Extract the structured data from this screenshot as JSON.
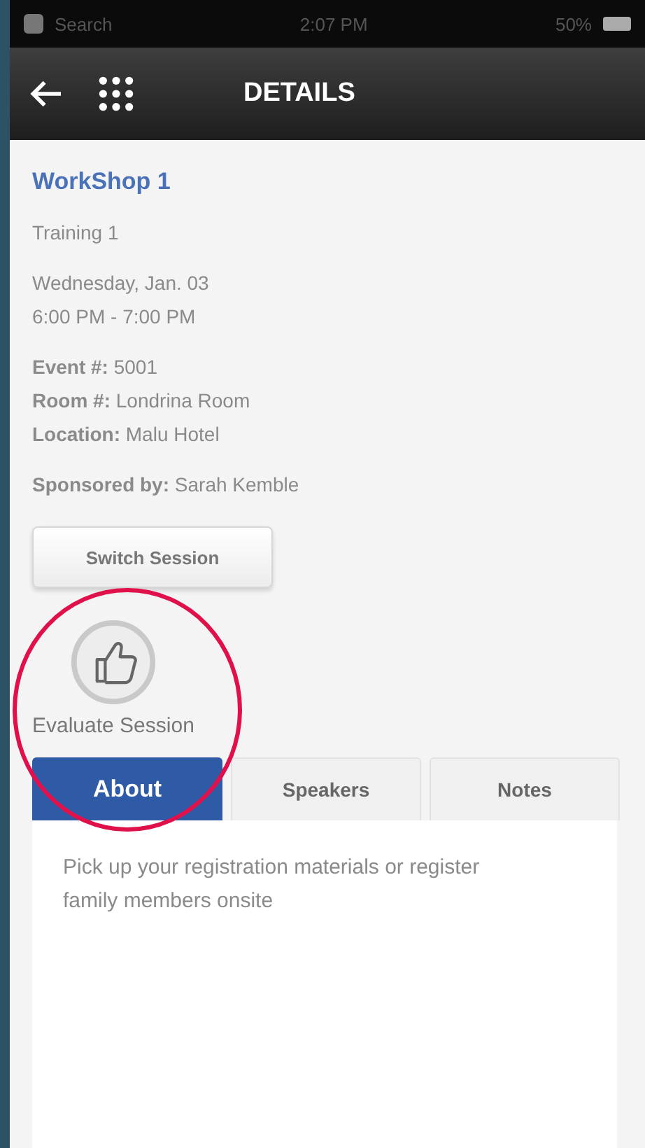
{
  "status_bar": {
    "carrier": "Search",
    "time": "2:07 PM",
    "battery": "50%"
  },
  "header": {
    "title": "DETAILS"
  },
  "session": {
    "title": "WorkShop 1",
    "subtitle": "Training 1",
    "date": "Wednesday, Jan. 03",
    "time": "6:00 PM - 7:00 PM",
    "details": [
      "**Event #:** 5001",
      "**Room #:** Londrina Room",
      "**Location:** Malu Hotel"
    ],
    "sponsor": "**Sponsored by:** Sarah Kemble"
  },
  "switch_button": "Switch Session",
  "evaluate": {
    "label": "Evaluate Session",
    "highlighted": true
  },
  "tabs": [
    {
      "label": "About",
      "selected": true
    },
    {
      "label": "Speakers",
      "selected": false
    },
    {
      "label": "Notes",
      "selected": false
    }
  ],
  "about_text": "Pick up your registration materials or register family members onsite"
}
